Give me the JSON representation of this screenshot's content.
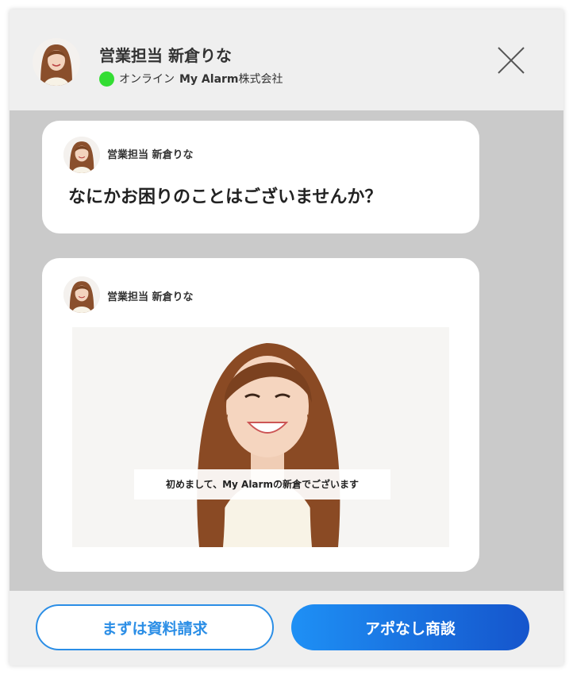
{
  "header": {
    "agent_name": "営業担当 新倉りな",
    "status": "オンライン",
    "company_name": "My Alarm",
    "company_suffix": "株式会社",
    "status_color": "#33dd33"
  },
  "messages": [
    {
      "sender": "営業担当 新倉りな",
      "text": "なにかお困りのことはございませんか？"
    },
    {
      "sender": "営業担当 新倉りな",
      "video_caption": "初めまして、My Alarmの新倉でございます"
    }
  ],
  "footer": {
    "secondary_button": "まずは資料請求",
    "primary_button": "アポなし商談"
  },
  "colors": {
    "accent": "#2b8ee6",
    "primary_gradient_start": "#1e90f5",
    "primary_gradient_end": "#1555cc",
    "chat_background": "#cacaca",
    "panel_background": "#efefef"
  },
  "icons": {
    "close": "close-icon",
    "avatar": "avatar"
  }
}
